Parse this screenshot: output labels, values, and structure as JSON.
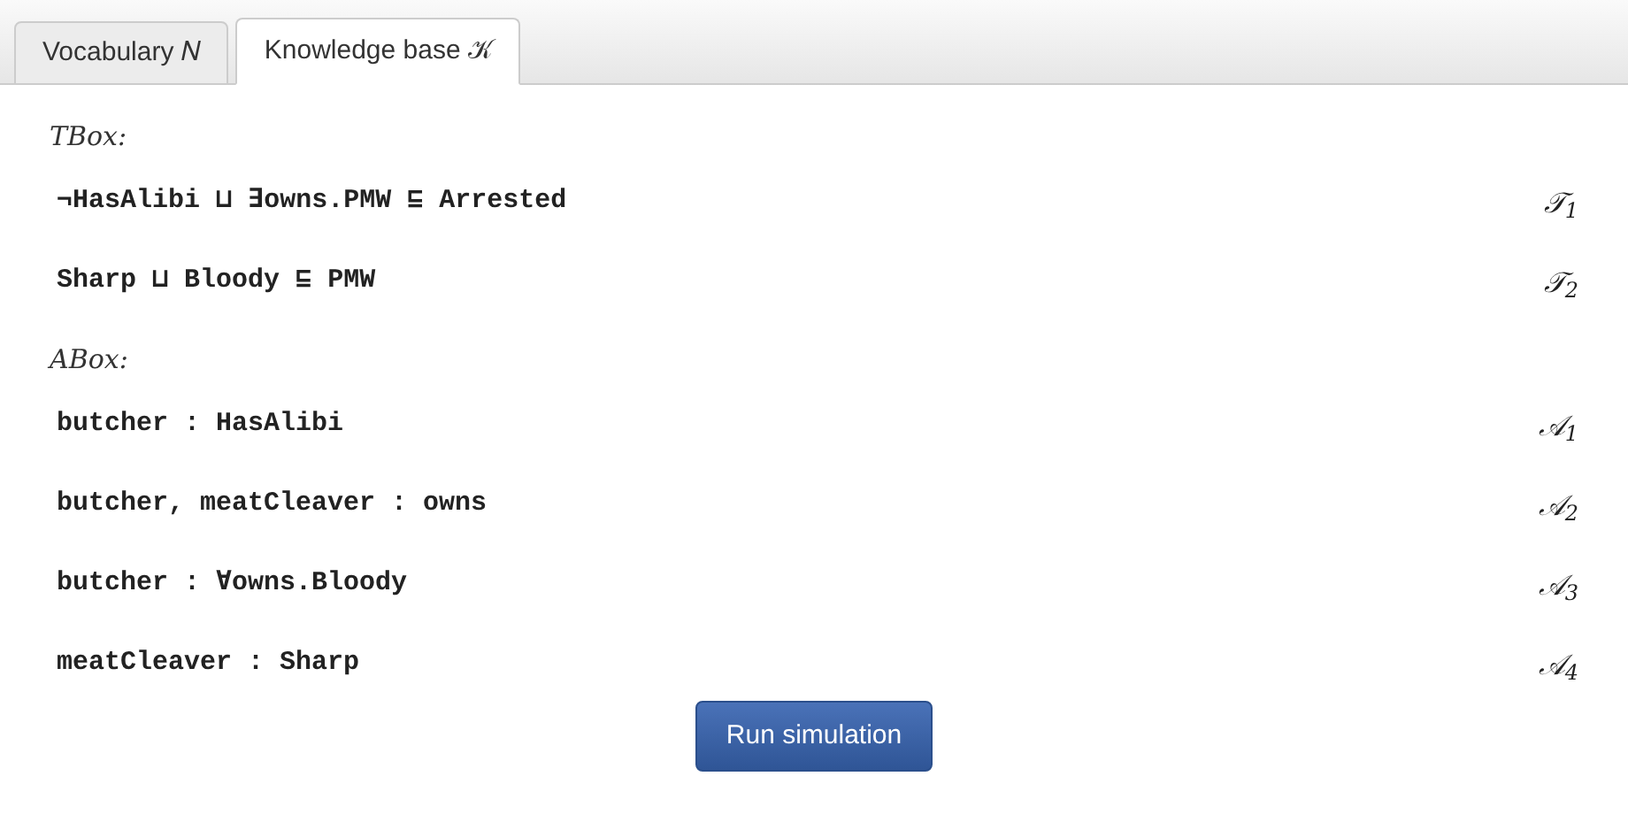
{
  "tabs": [
    {
      "label": "Vocabulary 𝑁",
      "selected": false
    },
    {
      "label": "Knowledge base 𝒦",
      "selected": true
    }
  ],
  "sections": [
    {
      "heading": "TBox:",
      "axioms": [
        {
          "formula": "¬HasAlibi ⊔ ∃owns.PMW ⊑ Arrested",
          "label": "𝒯$_{1}$"
        },
        {
          "formula": "Sharp ⊔ Bloody ⊑ PMW",
          "label": "𝒯$_{2}$"
        }
      ]
    },
    {
      "heading": "ABox:",
      "axioms": [
        {
          "formula": "butcher : HasAlibi",
          "label": "𝒜$_{1}$"
        },
        {
          "formula": "butcher, meatCleaver : owns",
          "label": "𝒜$_{2}$"
        },
        {
          "formula": "butcher : ∀owns.Bloody",
          "label": "𝒜$_{3}$"
        },
        {
          "formula": "meatCleaver : Sharp",
          "label": "𝒜$_{4}$"
        }
      ]
    }
  ],
  "button": "Run simulation"
}
